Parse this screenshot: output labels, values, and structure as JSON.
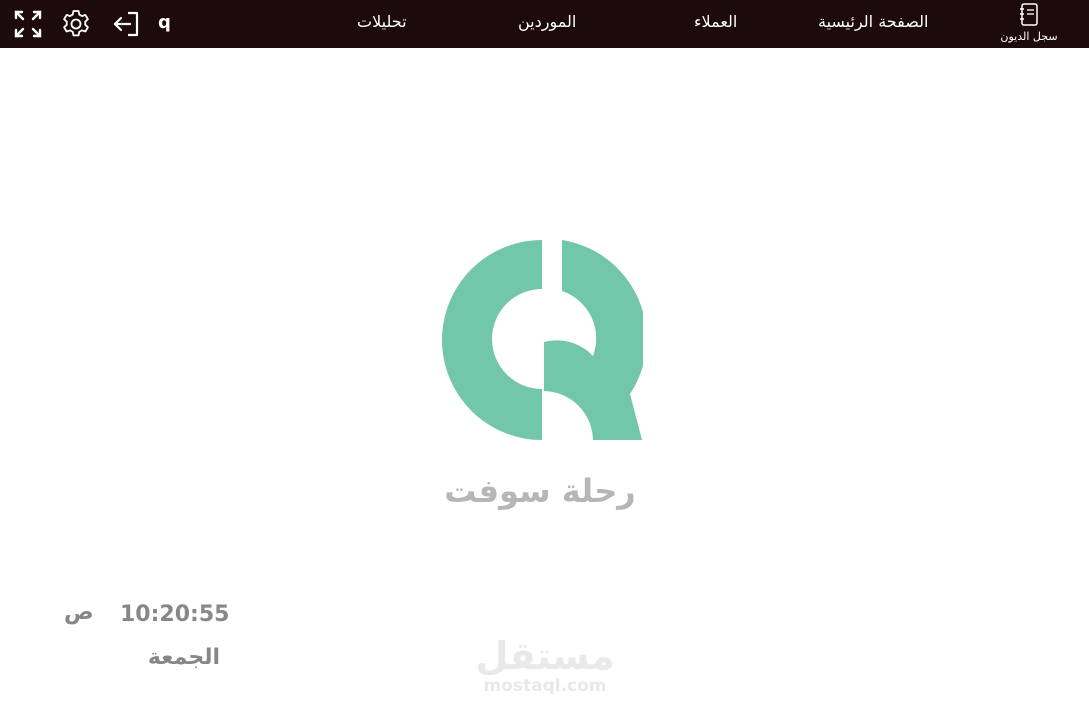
{
  "topbar": {
    "ledger_label": "سجل الديون",
    "nav": {
      "home": "الصفحة الرئيسية",
      "customers": "العملاء",
      "suppliers": "الموردين",
      "analytics": "تحليلات"
    },
    "user_initial": "q",
    "icons": {
      "ledger": "notebook-icon",
      "logout": "logout-icon",
      "settings": "gear-icon",
      "fullscreen": "fullscreen-icon"
    }
  },
  "brand": {
    "name": "رحلة سوفت",
    "logo_color": "#72c6a9"
  },
  "clock": {
    "time": "10:20:55",
    "period": "ص",
    "day": "الجمعة"
  },
  "watermark": {
    "arabic": "مستقل",
    "url": "mostaql.com"
  },
  "colors": {
    "topbar_bg": "#1d0b0b",
    "clock_text": "#878787",
    "brand_text": "#b6b6b6"
  }
}
